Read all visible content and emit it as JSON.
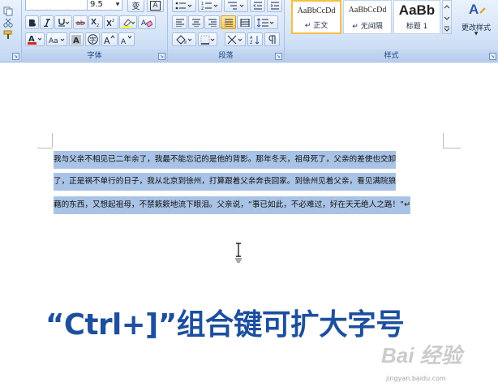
{
  "ribbon": {
    "font_group": {
      "label": "字体",
      "font_size_value": "9.5",
      "char_border_label": "A",
      "wen_label": "变"
    },
    "paragraph_group": {
      "label": "段落"
    },
    "styles_group": {
      "label": "样式",
      "cards": [
        {
          "sample": "AaBbCcDd",
          "name": "↵ 正文",
          "selected": true
        },
        {
          "sample": "AaBbCcDd",
          "name": "↵ 无间隔",
          "selected": false
        },
        {
          "sample": "AaBb",
          "name": "标题 1",
          "selected": false
        }
      ],
      "change_styles_label": "更改样式"
    }
  },
  "document": {
    "lines": [
      "我与父亲不相见已二年余了，我最不能忘记的是他的背影。那年冬天，祖母死了，父亲的差使也交卸",
      "了，正是祸不单行的日子，我从北京到徐州，打算跟着父亲奔丧回家。到徐州见着父亲，看见满院狼",
      "藉的东西，又想起祖母，不禁簌簌地流下眼泪。父亲说，“事已如此，不必难过，好在天无绝人之路！”↵"
    ]
  },
  "caption": {
    "text": "“Ctrl+]”组合键可扩大字号"
  },
  "watermark": {
    "brand": "Bai  经验",
    "url": "jingyan.baidu.com"
  },
  "colors": {
    "selection": "#a9c3e6",
    "caption": "#1d4f9e",
    "ribbon_top": "#eaf2fd",
    "ribbon_bottom": "#c3d7f1"
  }
}
